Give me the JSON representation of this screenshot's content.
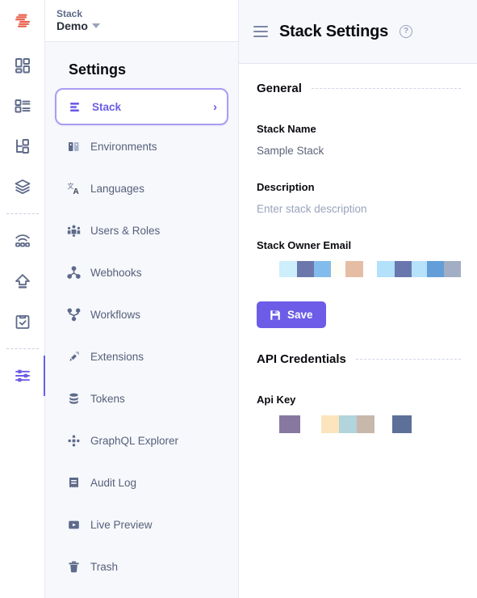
{
  "brand": {
    "logo_icon": "contentstack-logo-icon",
    "kicker": "Stack",
    "name": "Demo",
    "caret_icon": "chevron-down-icon",
    "accent": "#6c5ce7",
    "logo_color": "#e8604c"
  },
  "rail": {
    "items": [
      {
        "icon": "dashboard-blocks-icon",
        "name": "dashboard",
        "active": false
      },
      {
        "icon": "content-types-list-icon",
        "name": "content-types",
        "active": false
      },
      {
        "icon": "modular-blocks-icon",
        "name": "modular-blocks",
        "active": false
      },
      {
        "icon": "stack-layers-icon",
        "name": "assets",
        "active": false
      },
      {
        "icon": "live-edit-wifi-icon",
        "name": "live-edit",
        "active": false
      },
      {
        "icon": "publish-upload-icon",
        "name": "releases",
        "active": false
      },
      {
        "icon": "clipboard-check-icon",
        "name": "tasks",
        "active": false
      },
      {
        "icon": "settings-sliders-icon",
        "name": "settings",
        "active": true
      }
    ]
  },
  "settings_nav": {
    "title": "Settings",
    "items": [
      {
        "label": "Stack",
        "icon": "stack-bars-icon",
        "selected": true,
        "chevron": "chevron-right-icon"
      },
      {
        "label": "Environments",
        "icon": "environments-icon",
        "selected": false
      },
      {
        "label": "Languages",
        "icon": "languages-translate-icon",
        "selected": false
      },
      {
        "label": "Users & Roles",
        "icon": "users-roles-icon",
        "selected": false
      },
      {
        "label": "Webhooks",
        "icon": "webhooks-node-icon",
        "selected": false
      },
      {
        "label": "Workflows",
        "icon": "workflows-branch-icon",
        "selected": false
      },
      {
        "label": "Extensions",
        "icon": "extensions-plug-icon",
        "selected": false
      },
      {
        "label": "Tokens",
        "icon": "tokens-database-icon",
        "selected": false
      },
      {
        "label": "GraphQL Explorer",
        "icon": "graphql-icon",
        "selected": false
      },
      {
        "label": "Audit Log",
        "icon": "audit-log-receipt-icon",
        "selected": false
      },
      {
        "label": "Live Preview",
        "icon": "live-preview-play-icon",
        "selected": false
      },
      {
        "label": "Trash",
        "icon": "trash-bin-icon",
        "selected": false
      }
    ]
  },
  "main": {
    "menu_icon": "hamburger-menu-icon",
    "title": "Stack Settings",
    "help_icon": "help-circle-icon",
    "help_glyph": "?",
    "sections": [
      {
        "heading": "General",
        "fields": [
          {
            "label": "Stack Name",
            "value": "Sample Stack",
            "kind": "text"
          },
          {
            "label": "Description",
            "value": "Enter stack description",
            "kind": "placeholder"
          },
          {
            "label": "Stack Owner Email",
            "kind": "redacted"
          }
        ]
      },
      {
        "heading": "API Credentials",
        "fields": [
          {
            "label": "Api Key",
            "kind": "redacted"
          }
        ]
      }
    ],
    "save_button": {
      "label": "Save",
      "icon": "save-floppy-icon"
    }
  },
  "redactions": {
    "stack_owner_email": [
      {
        "w": 30,
        "color": "#cdeefb"
      },
      {
        "w": 28,
        "color": "#6c78ac"
      },
      {
        "w": 28,
        "color": "#82bced"
      },
      {
        "w": 24,
        "color": "#fefdf6"
      },
      {
        "w": 30,
        "color": "#e5bda4"
      },
      {
        "w": 22,
        "color": "transparent"
      },
      {
        "w": 30,
        "color": "#b3e0fb"
      },
      {
        "w": 28,
        "color": "#6878ae"
      },
      {
        "w": 26,
        "color": "#b7e2fb"
      },
      {
        "w": 28,
        "color": "#639ed8"
      },
      {
        "w": 28,
        "color": "#a2aec3"
      }
    ],
    "api_key": [
      {
        "w": 26,
        "color": "#87789f"
      },
      {
        "w": 26,
        "color": "transparent"
      },
      {
        "w": 22,
        "color": "#fce4bc"
      },
      {
        "w": 22,
        "color": "#b2d4dc"
      },
      {
        "w": 22,
        "color": "#c8b7ab"
      },
      {
        "w": 22,
        "color": "transparent"
      },
      {
        "w": 24,
        "color": "#5c7099"
      }
    ]
  }
}
